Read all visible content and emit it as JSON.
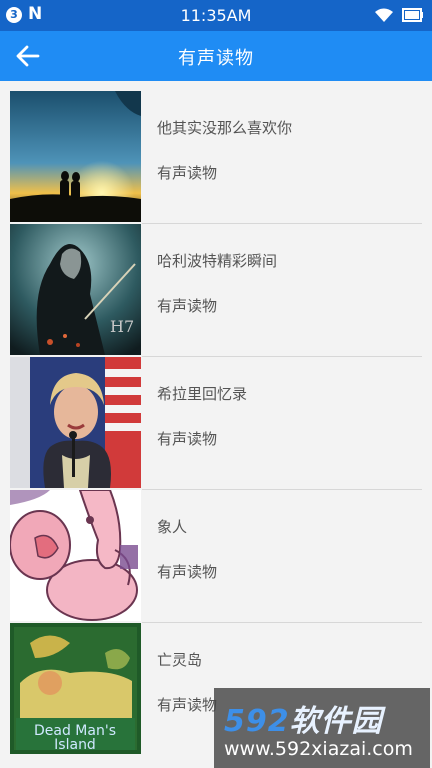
{
  "status_bar": {
    "notification_count": "3",
    "carrier_icon": "n-icon",
    "time": "11:35AM",
    "icons": [
      "wifi-icon",
      "battery-icon"
    ]
  },
  "app_bar": {
    "back_icon": "arrow-left-icon",
    "title": "有声读物"
  },
  "items": [
    {
      "title": "他其实没那么喜欢你",
      "subtitle": "有声读物",
      "thumbnail": "sunset-couple"
    },
    {
      "title": "哈利波特精彩瞬间",
      "subtitle": "有声读物",
      "thumbnail": "harry-potter-poster"
    },
    {
      "title": "希拉里回忆录",
      "subtitle": "有声读物",
      "thumbnail": "speaker-flag"
    },
    {
      "title": "象人",
      "subtitle": "有声读物",
      "thumbnail": "cartoon-elephant"
    },
    {
      "title": "亡灵岛",
      "subtitle": "有声读物",
      "thumbnail": "dead-mans-island-cover",
      "cover_text": "Dead Man's Island"
    }
  ],
  "watermark": {
    "logo_number": "592",
    "logo_text": "软件园",
    "url": "www.592xiazai.com"
  },
  "colors": {
    "status_bar": "#1565c8",
    "app_bar": "#1f8cf4",
    "background": "#f3f3f3",
    "text": "#555555"
  }
}
